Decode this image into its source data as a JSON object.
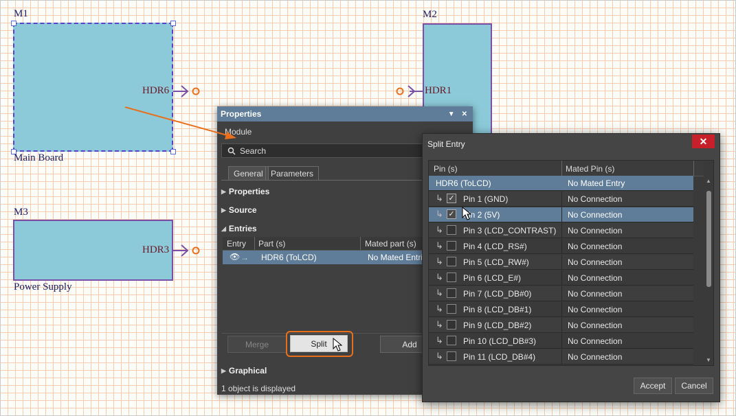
{
  "schematic": {
    "m1": {
      "designator": "M1",
      "caption": "Main Board",
      "port": "HDR6"
    },
    "m2": {
      "designator": "M2",
      "port": "HDR1"
    },
    "m3": {
      "designator": "M3",
      "caption": "Power Supply",
      "port": "HDR3"
    }
  },
  "properties": {
    "title": "Properties",
    "subtitle": "Module",
    "search_placeholder": "Search",
    "tabs": [
      "General",
      "Parameters"
    ],
    "sections": {
      "properties": "Properties",
      "source": "Source",
      "entries": "Entries",
      "graphical": "Graphical"
    },
    "grid": {
      "headers": [
        "Entry",
        "Part (s)",
        "Mated part (s)"
      ],
      "row": {
        "part": "HDR6 (ToLCD)",
        "mated": "No Mated Entri"
      }
    },
    "buttons": {
      "merge": "Merge",
      "split": "Split",
      "add": "Add"
    },
    "status": "1 object is displayed"
  },
  "split_entry": {
    "title": "Split Entry",
    "close": "✕",
    "headers": {
      "pin": "Pin (s)",
      "mated": "Mated Pin (s)"
    },
    "group": {
      "pin": "HDR6 (ToLCD)",
      "mated": "No Mated Entry"
    },
    "rows": [
      {
        "pin": "Pin 1 (GND)",
        "mated": "No Connection",
        "checked": true
      },
      {
        "pin": "Pin 2 (5V)",
        "mated": "No Connection",
        "checked": true
      },
      {
        "pin": "Pin 3 (LCD_CONTRAST)",
        "mated": "No Connection",
        "checked": false
      },
      {
        "pin": "Pin 4 (LCD_RS#)",
        "mated": "No Connection",
        "checked": false
      },
      {
        "pin": "Pin 5 (LCD_RW#)",
        "mated": "No Connection",
        "checked": false
      },
      {
        "pin": "Pin 6 (LCD_E#)",
        "mated": "No Connection",
        "checked": false
      },
      {
        "pin": "Pin 7 (LCD_DB#0)",
        "mated": "No Connection",
        "checked": false
      },
      {
        "pin": "Pin 8 (LCD_DB#1)",
        "mated": "No Connection",
        "checked": false
      },
      {
        "pin": "Pin 9 (LCD_DB#2)",
        "mated": "No Connection",
        "checked": false
      },
      {
        "pin": "Pin 10 (LCD_DB#3)",
        "mated": "No Connection",
        "checked": false
      },
      {
        "pin": "Pin 11 (LCD_DB#4)",
        "mated": "No Connection",
        "checked": false
      }
    ],
    "buttons": {
      "accept": "Accept",
      "cancel": "Cancel"
    }
  },
  "colors": {
    "accent": "#5f7c98",
    "highlight": "#e8701c",
    "module_fill": "#8ccad9",
    "module_border": "#7a4fa8"
  }
}
